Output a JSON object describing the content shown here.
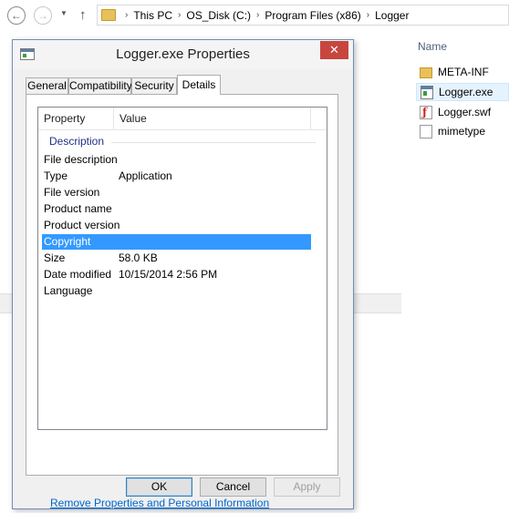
{
  "explorer": {
    "breadcrumbs": [
      "This PC",
      "OS_Disk (C:)",
      "Program Files (x86)",
      "Logger"
    ],
    "column_header": "Name",
    "files": [
      {
        "name": "META-INF",
        "icon": "folder-icon"
      },
      {
        "name": "Logger.exe",
        "icon": "exe-icon",
        "selected": true
      },
      {
        "name": "Logger.swf",
        "icon": "swf-icon"
      },
      {
        "name": "mimetype",
        "icon": "file-icon"
      }
    ]
  },
  "dialog": {
    "title": "Logger.exe Properties",
    "close_label": "✕",
    "tabs": [
      "General",
      "Compatibility",
      "Security",
      "Details"
    ],
    "active_tab": "Details",
    "columns": {
      "property": "Property",
      "value": "Value"
    },
    "group": "Description",
    "properties": [
      {
        "name": "File description",
        "value": ""
      },
      {
        "name": "Type",
        "value": "Application"
      },
      {
        "name": "File version",
        "value": ""
      },
      {
        "name": "Product name",
        "value": ""
      },
      {
        "name": "Product version",
        "value": ""
      },
      {
        "name": "Copyright",
        "value": "",
        "selected": true
      },
      {
        "name": "Size",
        "value": "58.0 KB"
      },
      {
        "name": "Date modified",
        "value": "10/15/2014 2:56 PM"
      },
      {
        "name": "Language",
        "value": ""
      }
    ],
    "remove_link": "Remove Properties and Personal Information",
    "buttons": {
      "ok": "OK",
      "cancel": "Cancel",
      "apply": "Apply"
    },
    "colors": {
      "selection": "#3399ff",
      "link": "#0066cc",
      "close": "#c7463d"
    }
  }
}
